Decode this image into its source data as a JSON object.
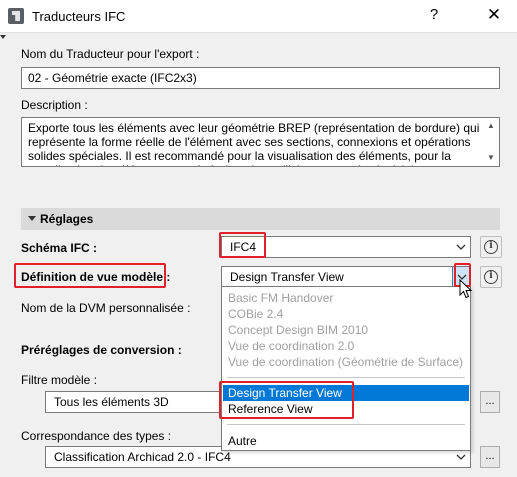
{
  "window": {
    "title": "Traducteurs IFC",
    "help_label": "?",
    "close_label": "✕"
  },
  "translator_name": {
    "label": "Nom du Traducteur pour l'export :",
    "value": "02 - Géométrie exacte (IFC2x3)"
  },
  "description": {
    "label": "Description :",
    "text": "Exporte tous les éléments avec leur géométrie BREP (représentation de bordure) qui représente la forme réelle de l'élément avec ses sections, connexions et opérations solides spéciales. Il est recommandé pour la visualisation des éléments, pour la coordination des éléments en générale et les collisions, avec des logiciels"
  },
  "settings_section": {
    "title": "Réglages"
  },
  "ifc_schema": {
    "label": "Schéma IFC :",
    "value": "IFC4"
  },
  "mvd": {
    "label": "Définition de vue modèle :",
    "value": "Design Transfer View",
    "custom_label": "Nom de la DVM personnalisée :"
  },
  "conversion": {
    "title": "Préréglages de conversion :",
    "model_filter_label": "Filtre modèle :",
    "model_filter_value": "Tous les éléments 3D",
    "type_mapping_label": "Correspondance des types :",
    "type_mapping_value": "Classification Archicad 2.0 - IFC4",
    "browse_label": "..."
  },
  "dropdown": {
    "disabled_items": [
      "Basic FM Handover",
      "COBie 2.4",
      "Concept Design BIM 2010",
      "Vue de coordination 2.0",
      "Vue de coordination (Géométrie de Surface)"
    ],
    "selected_item": "Design Transfer View",
    "reference_item": "Reference View",
    "other_item": "Autre"
  },
  "colors": {
    "highlight": "#0078d7",
    "annotation_red": "#e2202c",
    "dialog_bg": "#f0f0f0",
    "section_bar": "#dadada"
  }
}
